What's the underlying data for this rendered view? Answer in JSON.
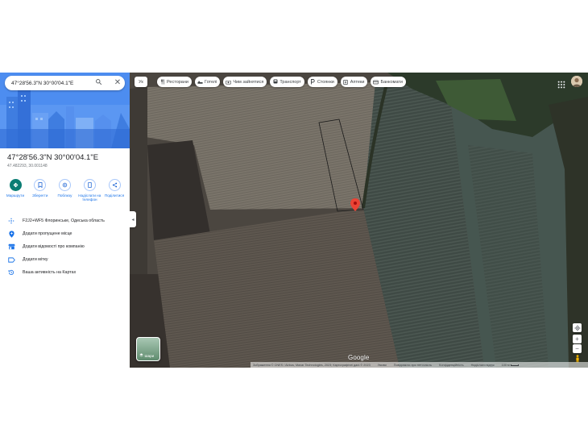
{
  "search": {
    "value": "47°28'56.3\"N 30°00'04.1\"E"
  },
  "place": {
    "title": "47°28'56.3\"N 30°00'04.1\"E",
    "decimal": "47.482293, 30.001148"
  },
  "actions": [
    {
      "label": "Маршрути",
      "icon": "directions-icon"
    },
    {
      "label": "Зберегти",
      "icon": "bookmark-icon"
    },
    {
      "label": "Поблизу",
      "icon": "nearby-icon"
    },
    {
      "label": "Надіслати на телефон",
      "icon": "phone-icon"
    },
    {
      "label": "Поділитися",
      "icon": "share-icon"
    }
  ],
  "info": [
    {
      "text": "F2J2+WF5 Флоринське, Одеська область",
      "icon": "plus-code-icon"
    },
    {
      "text": "Додати пропущене місце",
      "icon": "add-place-icon"
    },
    {
      "text": "Додати відомості про компанію",
      "icon": "business-icon"
    },
    {
      "text": "Додати мітку",
      "icon": "label-icon"
    },
    {
      "text": "Ваша активність на Картах",
      "icon": "history-icon"
    }
  ],
  "map": {
    "language_button": "Ук",
    "chips": [
      {
        "label": "Ресторани",
        "icon": "restaurant-icon"
      },
      {
        "label": "Готелі",
        "icon": "hotel-icon"
      },
      {
        "label": "Чим зайнятися",
        "icon": "camera-icon"
      },
      {
        "label": "Транспорт",
        "icon": "transit-icon"
      },
      {
        "label": "Стоянки",
        "icon": "parking-icon"
      },
      {
        "label": "Аптеки",
        "icon": "pharmacy-icon"
      },
      {
        "label": "Банкомати",
        "icon": "atm-icon"
      }
    ],
    "layers_label": "Шари",
    "google_logo": "Google",
    "attribution": [
      "Зображення © CNES / Airbus, Maxar Technologies, 2023; Картографічні дані © 2023",
      "Умови",
      "Повідомити про неточність",
      "Конфіденційність",
      "Надіслати відгук",
      "100 м"
    ]
  },
  "colors": {
    "accent": "#1a73e8",
    "primary_action": "#0b7d74",
    "pin": "#ea4335",
    "hero": "#4d8df0"
  }
}
